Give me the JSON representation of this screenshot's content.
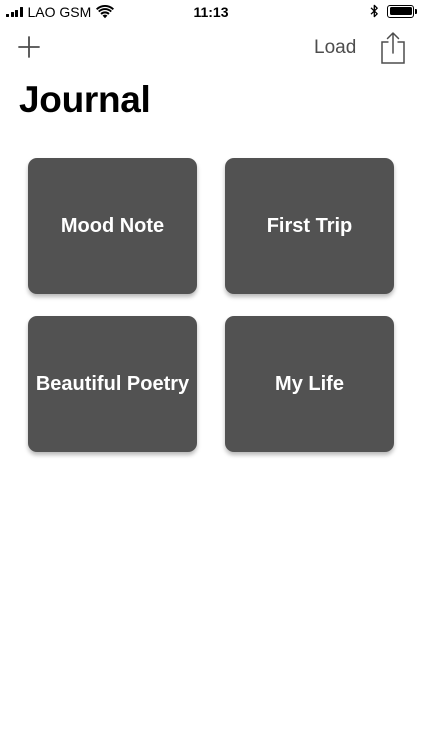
{
  "status_bar": {
    "carrier": "LAO GSM",
    "time": "11:13",
    "signal_icon": "signal-bars-icon",
    "wifi_icon": "wifi-icon",
    "bluetooth_icon": "bluetooth-icon",
    "battery_icon": "battery-icon",
    "battery_level": 1.0
  },
  "nav": {
    "add_icon": "plus-icon",
    "load_label": "Load",
    "share_icon": "share-icon"
  },
  "page_title": "Journal",
  "journals": [
    {
      "label": "Mood Note"
    },
    {
      "label": "First Trip"
    },
    {
      "label": "Beautiful Poetry"
    },
    {
      "label": "My Life"
    }
  ],
  "colors": {
    "card_background": "#525252",
    "card_text": "#ffffff",
    "nav_text": "#4d4d4d",
    "background": "#ffffff"
  }
}
